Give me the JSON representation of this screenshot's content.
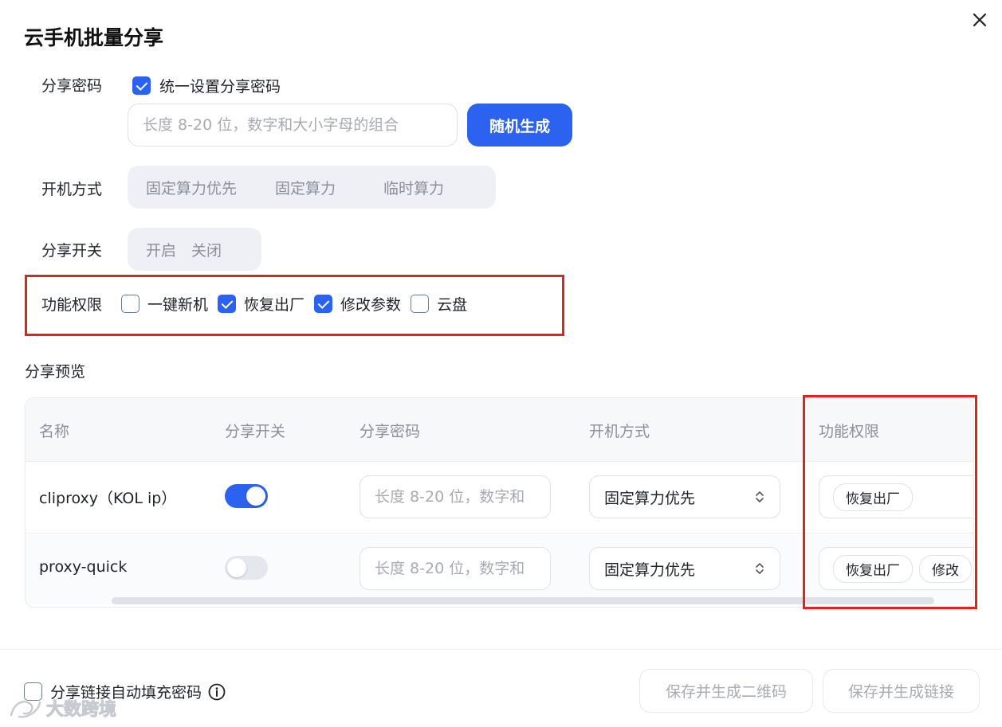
{
  "dialog": {
    "title": "云手机批量分享"
  },
  "form": {
    "password": {
      "label": "分享密码",
      "unify_checkbox_label": "统一设置分享密码",
      "unify_checked": true,
      "placeholder": "长度 8-20 位，数字和大小字母的组合",
      "value": "",
      "random_button": "随机生成"
    },
    "boot_mode": {
      "label": "开机方式",
      "options": [
        "固定算力优先",
        "固定算力",
        "临时算力"
      ]
    },
    "share_switch": {
      "label": "分享开关",
      "options": [
        "开启",
        "关闭"
      ]
    },
    "permissions": {
      "label": "功能权限",
      "options": [
        {
          "label": "一键新机",
          "checked": false
        },
        {
          "label": "恢复出厂",
          "checked": true
        },
        {
          "label": "修改参数",
          "checked": true
        },
        {
          "label": "云盘",
          "checked": false
        }
      ]
    }
  },
  "preview": {
    "title": "分享预览",
    "columns": [
      "名称",
      "分享开关",
      "分享密码",
      "开机方式",
      "功能权限"
    ],
    "rows": [
      {
        "name": "cliproxy（KOL ip）",
        "share_on": true,
        "password_placeholder": "长度 8-20 位，数字和",
        "boot_mode": "固定算力优先",
        "permissions": [
          "恢复出厂"
        ]
      },
      {
        "name": "proxy-quick",
        "share_on": false,
        "password_placeholder": "长度 8-20 位，数字和",
        "boot_mode": "固定算力优先",
        "permissions": [
          "恢复出厂",
          "修改"
        ]
      }
    ]
  },
  "footer": {
    "autofill_label": "分享链接自动填充密码",
    "autofill_checked": false,
    "qr_button": "保存并生成二维码",
    "link_button": "保存并生成链接"
  },
  "watermark": {
    "text": "大数跨境"
  },
  "colors": {
    "primary": "#2b63f0",
    "highlight_box": "#e0231c",
    "muted_text": "#8a8f99"
  }
}
